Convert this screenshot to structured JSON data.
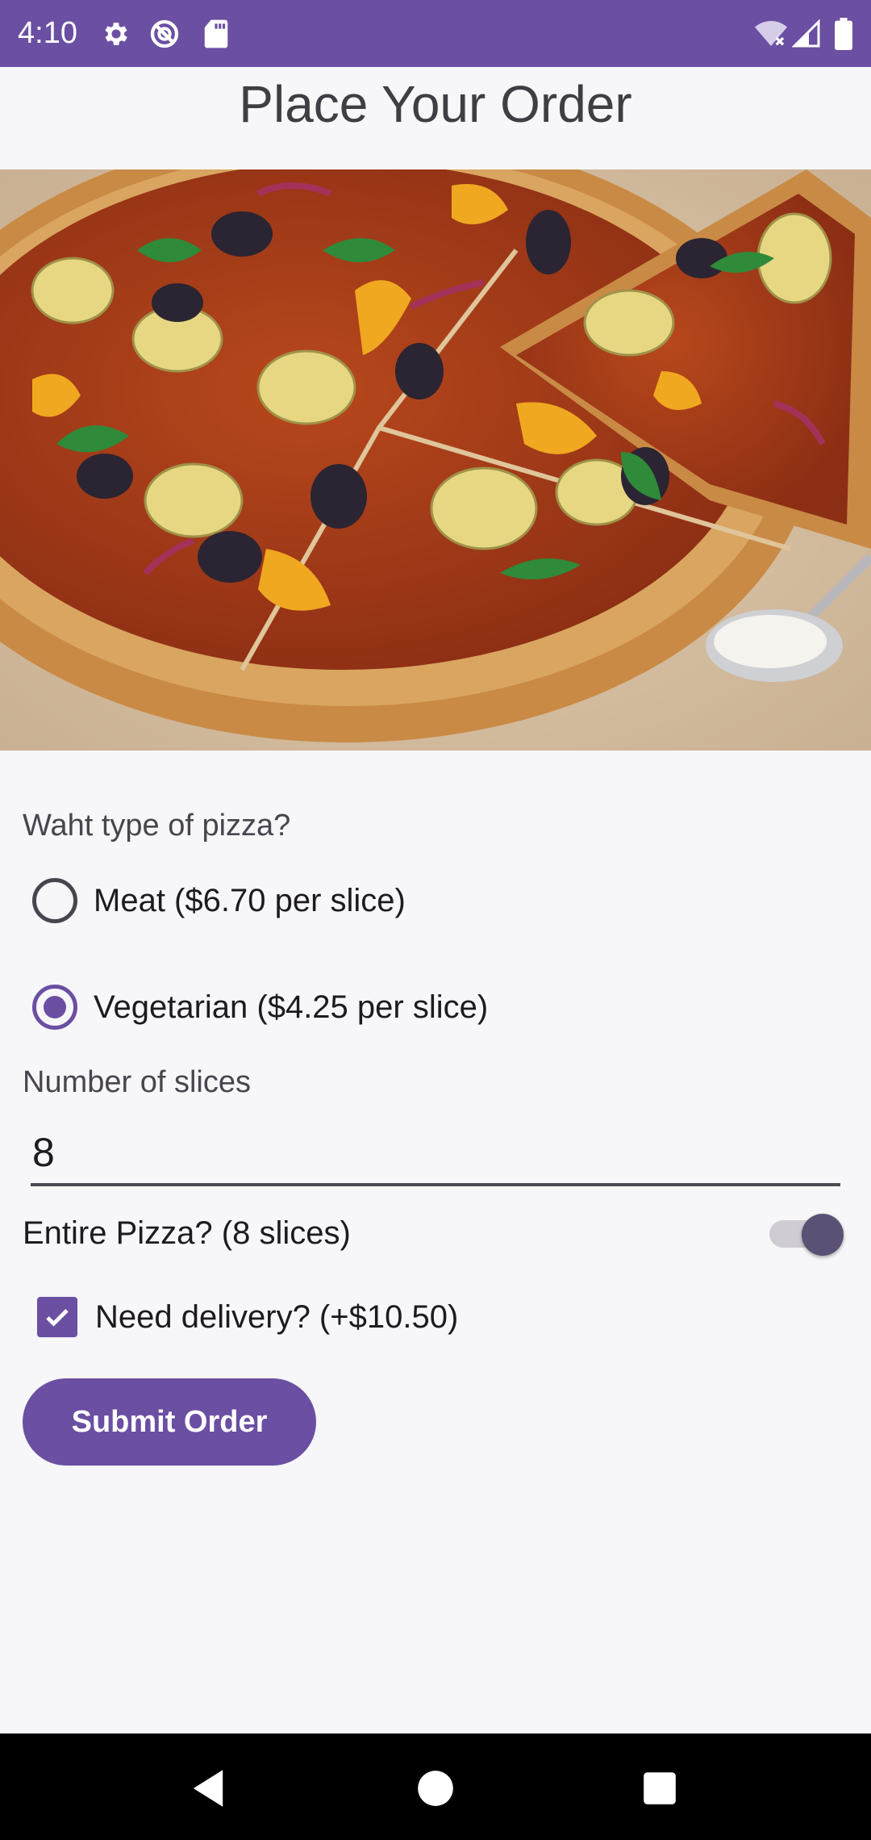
{
  "status_bar": {
    "time": "4:10",
    "left_icons": [
      "gear-icon",
      "do-not-disturb-icon",
      "sd-card-icon"
    ],
    "right_icons": [
      "wifi-off-icon",
      "cell-signal-icon",
      "battery-icon"
    ]
  },
  "page": {
    "title": "Place Your Order",
    "hero_image": "pizza-photo"
  },
  "form": {
    "pizza_type_label": "Waht type of pizza?",
    "options": [
      {
        "label": "Meat ($6.70 per slice)",
        "selected": false
      },
      {
        "label": "Vegetarian ($4.25 per slice)",
        "selected": true
      }
    ],
    "slices_label": "Number of slices",
    "slices_value": "8",
    "entire_pizza_label": "Entire Pizza? (8 slices)",
    "entire_pizza_on": true,
    "delivery_label": "Need delivery? (+$10.50)",
    "delivery_checked": true,
    "submit_label": "Submit Order"
  },
  "nav_bar": {
    "buttons": [
      "back-icon",
      "home-icon",
      "recents-icon"
    ]
  },
  "colors": {
    "accent": "#6a4fa3",
    "background": "#f7f6f8",
    "switch_thumb": "#5a5174"
  }
}
